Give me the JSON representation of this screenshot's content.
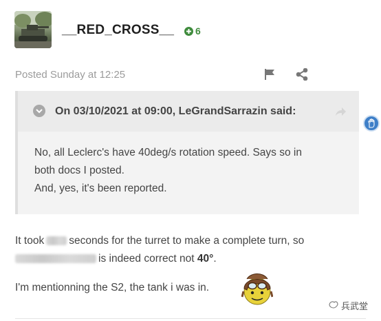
{
  "post": {
    "username": "__RED_CROSS__",
    "reputation": "6",
    "posted": "Posted Sunday at 12:25"
  },
  "quote": {
    "cite": "On 03/10/2021 at 09:00, LeGrandSarrazin said:",
    "lines": [
      "No, all Leclerc's have 40deg/s rotation speed. Says so in",
      "both docs I posted.",
      "And, yes, it's been reported."
    ]
  },
  "body": {
    "p1_prefix": "It took",
    "p1_suffix": "seconds for the turret to make a complete turn, so",
    "p2_suffix": "is indeed correct not",
    "p2_bold": "40°",
    "p2_end": ".",
    "p3": "I'm mentionning the S2, the tank i was in."
  },
  "watermark": "兵武堂",
  "icons": [
    "reputation-plus-icon",
    "flag-icon",
    "share-icon",
    "collapse-chevron-icon",
    "quote-link-arrow-icon",
    "help-hand-icon",
    "aviator-emoji-icon",
    "watermark-logo-icon"
  ],
  "colors": {
    "reputation": "#3f8b3c",
    "help_bubble": "#3e7fc8",
    "quote_bg": "#f3f3f3"
  }
}
